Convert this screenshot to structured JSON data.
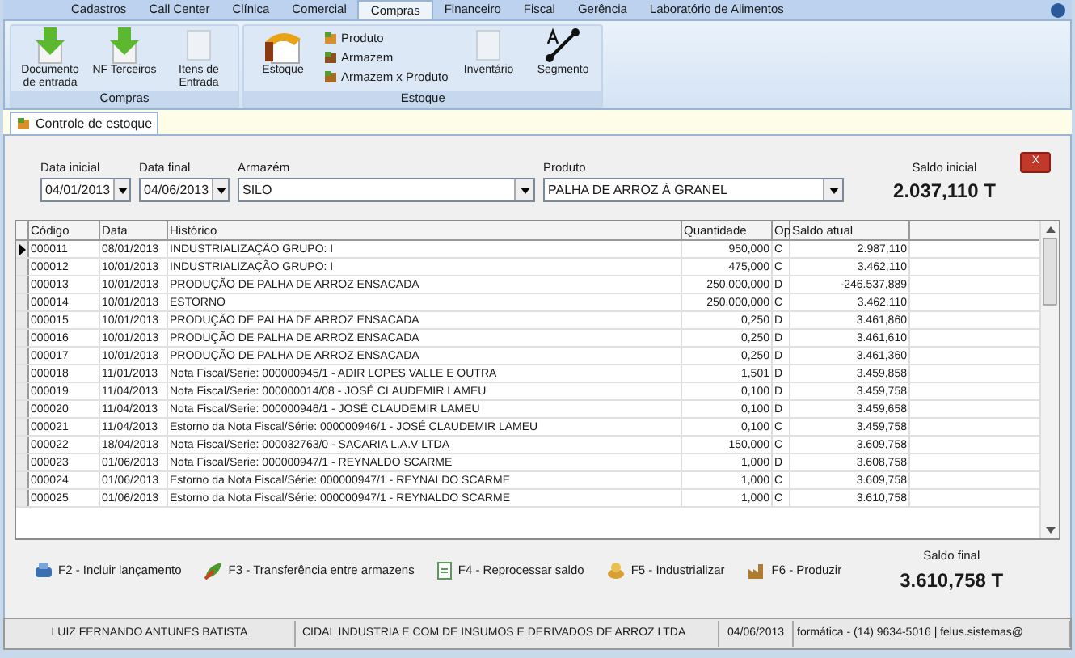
{
  "menu_tabs": [
    {
      "label": "Cadastros",
      "selected": false
    },
    {
      "label": "Call Center",
      "selected": false
    },
    {
      "label": "Clínica",
      "selected": false
    },
    {
      "label": "Comercial",
      "selected": false
    },
    {
      "label": "Compras",
      "selected": true
    },
    {
      "label": "Financeiro",
      "selected": false
    },
    {
      "label": "Fiscal",
      "selected": false
    },
    {
      "label": "Gerência",
      "selected": false
    },
    {
      "label": "Laboratório de Alimentos",
      "selected": false
    }
  ],
  "ribbon_groups": [
    {
      "title": "Compras",
      "items": [
        {
          "kind": "large",
          "label": "Documento de entrada"
        },
        {
          "kind": "large",
          "label": "NF Terceiros"
        },
        {
          "kind": "large",
          "label": "Itens de Entrada"
        }
      ]
    },
    {
      "title": "Estoque",
      "items": [
        {
          "kind": "large",
          "label": "Estoque"
        },
        {
          "kind": "stack",
          "entries": [
            "Produto",
            "Armazem",
            "Armazem x Produto"
          ]
        },
        {
          "kind": "large",
          "label": "Inventário"
        },
        {
          "kind": "large",
          "label": "Segmento"
        }
      ]
    }
  ],
  "document_tab": {
    "label": "Controle de estoque"
  },
  "filters": {
    "data_inicial": {
      "label": "Data inicial",
      "value": "04/01/2013"
    },
    "data_final": {
      "label": "Data final",
      "value": "04/06/2013"
    },
    "armazem": {
      "label": "Armazém",
      "value": "SILO"
    },
    "produto": {
      "label": "Produto",
      "value": "PALHA DE ARROZ À GRANEL"
    }
  },
  "saldo_inicial": {
    "label": "Saldo inicial",
    "value": "2.037,110 T"
  },
  "close_button": {
    "label": "X"
  },
  "table": {
    "columns": [
      "Código",
      "Data",
      "Histórico",
      "Quantidade",
      "Op",
      "Saldo atual"
    ],
    "rows": [
      {
        "selected": true,
        "cells": [
          "000011",
          "08/01/2013",
          "INDUSTRIALIZAÇÃO GRUPO: I",
          "950,000",
          "C",
          "2.987,110"
        ]
      },
      {
        "selected": false,
        "cells": [
          "000012",
          "10/01/2013",
          "INDUSTRIALIZAÇÃO GRUPO: I",
          "475,000",
          "C",
          "3.462,110"
        ]
      },
      {
        "selected": false,
        "cells": [
          "000013",
          "10/01/2013",
          "PRODUÇÃO DE PALHA DE ARROZ ENSACADA",
          "250.000,000",
          "D",
          "-246.537,889"
        ]
      },
      {
        "selected": false,
        "cells": [
          "000014",
          "10/01/2013",
          "ESTORNO",
          "250.000,000",
          "C",
          "3.462,110"
        ]
      },
      {
        "selected": false,
        "cells": [
          "000015",
          "10/01/2013",
          "PRODUÇÃO DE PALHA DE ARROZ ENSACADA",
          "0,250",
          "D",
          "3.461,860"
        ]
      },
      {
        "selected": false,
        "cells": [
          "000016",
          "10/01/2013",
          "PRODUÇÃO DE PALHA DE ARROZ ENSACADA",
          "0,250",
          "D",
          "3.461,610"
        ]
      },
      {
        "selected": false,
        "cells": [
          "000017",
          "10/01/2013",
          "PRODUÇÃO DE PALHA DE ARROZ ENSACADA",
          "0,250",
          "D",
          "3.461,360"
        ]
      },
      {
        "selected": false,
        "cells": [
          "000018",
          "11/01/2013",
          "Nota Fiscal/Serie: 000000945/1 - ADIR LOPES VALLE E OUTRA",
          "1,501",
          "D",
          "3.459,858"
        ]
      },
      {
        "selected": false,
        "cells": [
          "000019",
          "11/04/2013",
          "Nota Fiscal/Serie: 000000014/08 - JOSÉ CLAUDEMIR LAMEU",
          "0,100",
          "D",
          "3.459,758"
        ]
      },
      {
        "selected": false,
        "cells": [
          "000020",
          "11/04/2013",
          "Nota Fiscal/Serie: 000000946/1 - JOSÉ CLAUDEMIR LAMEU",
          "0,100",
          "D",
          "3.459,658"
        ]
      },
      {
        "selected": false,
        "cells": [
          "000021",
          "11/04/2013",
          "Estorno da Nota Fiscal/Série: 000000946/1 - JOSÉ CLAUDEMIR LAMEU",
          "0,100",
          "C",
          "3.459,758"
        ]
      },
      {
        "selected": false,
        "cells": [
          "000022",
          "18/04/2013",
          "Nota Fiscal/Serie: 000032763/0 - SACARIA L.A.V LTDA",
          "150,000",
          "C",
          "3.609,758"
        ]
      },
      {
        "selected": false,
        "cells": [
          "000023",
          "01/06/2013",
          "Nota Fiscal/Serie: 000000947/1 - REYNALDO SCARME",
          "1,000",
          "D",
          "3.608,758"
        ]
      },
      {
        "selected": false,
        "cells": [
          "000024",
          "01/06/2013",
          "Estorno da Nota Fiscal/Série: 000000947/1 - REYNALDO SCARME",
          "1,000",
          "C",
          "3.609,758"
        ]
      },
      {
        "selected": false,
        "cells": [
          "000025",
          "01/06/2013",
          "Estorno da Nota Fiscal/Série: 000000947/1 - REYNALDO SCARME",
          "1,000",
          "C",
          "3.610,758"
        ]
      }
    ]
  },
  "actions": [
    {
      "label": "F2 - Incluir lançamento"
    },
    {
      "label": "F3 - Transferência entre armazens"
    },
    {
      "label": "F4 - Reprocessar saldo"
    },
    {
      "label": "F5 - Industrializar"
    },
    {
      "label": "F6 - Produzir"
    }
  ],
  "saldo_final": {
    "label": "Saldo final",
    "value": "3.610,758 T"
  },
  "status_bar": [
    "LUIZ FERNANDO ANTUNES BATISTA",
    "CIDAL INDUSTRIA E COM DE INSUMOS E DERIVADOS DE ARROZ LTDA",
    "04/06/2013",
    "formática -  (14) 9634-5016 | felus.sistemas@"
  ]
}
